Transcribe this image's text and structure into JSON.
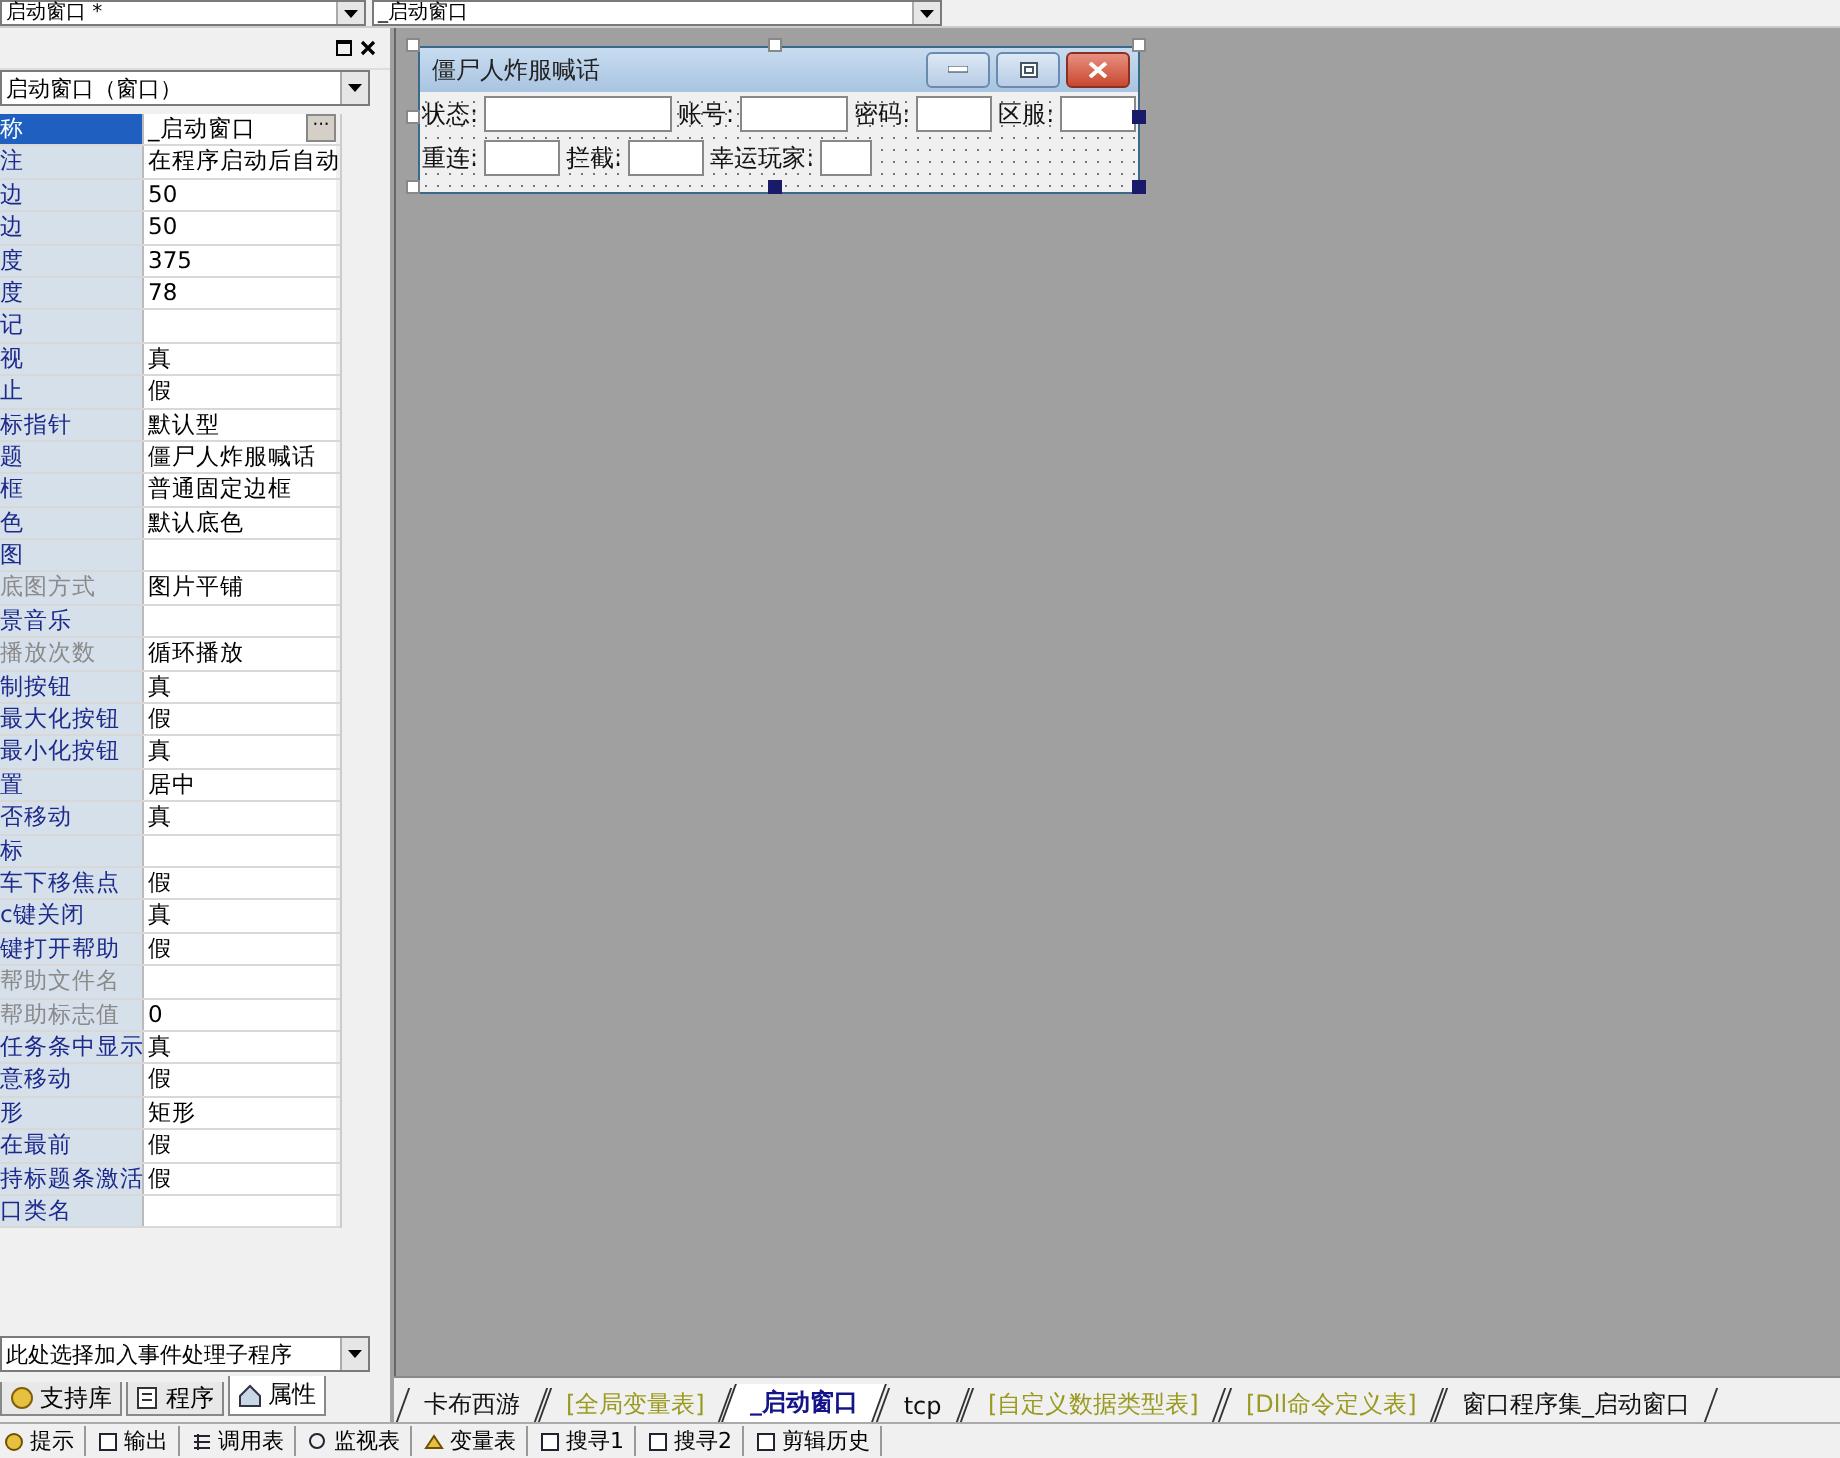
{
  "top_bar": {
    "object_combo": "启动窗口 *",
    "event_combo": "_启动窗口"
  },
  "property_panel": {
    "object_select": "启动窗口（窗口）",
    "edit_button": "···",
    "properties": [
      {
        "name": "称",
        "value": "_启动窗口",
        "selected": true,
        "disabled": false
      },
      {
        "name": "注",
        "value": "在程序启动后自动",
        "selected": false,
        "disabled": false
      },
      {
        "name": "边",
        "value": "50",
        "selected": false,
        "disabled": false
      },
      {
        "name": "边",
        "value": "50",
        "selected": false,
        "disabled": false
      },
      {
        "name": "度",
        "value": "375",
        "selected": false,
        "disabled": false
      },
      {
        "name": "度",
        "value": "78",
        "selected": false,
        "disabled": false
      },
      {
        "name": "记",
        "selected": false,
        "disabled": false
      },
      {
        "name": "视",
        "value": "真",
        "selected": false,
        "disabled": false
      },
      {
        "name": "止",
        "value": "假",
        "selected": false,
        "disabled": false
      },
      {
        "name": "标指针",
        "value": "默认型",
        "selected": false,
        "disabled": false
      },
      {
        "name": "题",
        "value": "僵尸人炸服喊话",
        "selected": false,
        "disabled": false
      },
      {
        "name": "框",
        "value": "普通固定边框",
        "selected": false,
        "disabled": false
      },
      {
        "name": "色",
        "value": "默认底色",
        "selected": false,
        "disabled": false
      },
      {
        "name": "图",
        "selected": false,
        "disabled": false
      },
      {
        "name": "底图方式",
        "value": "图片平铺",
        "selected": false,
        "disabled": true
      },
      {
        "name": "景音乐",
        "selected": false,
        "disabled": false
      },
      {
        "name": "播放次数",
        "value": "循环播放",
        "selected": false,
        "disabled": true
      },
      {
        "name": "制按钮",
        "value": "真",
        "selected": false,
        "disabled": false
      },
      {
        "name": "最大化按钮",
        "value": "假",
        "selected": false,
        "disabled": false
      },
      {
        "name": "最小化按钮",
        "value": "真",
        "selected": false,
        "disabled": false
      },
      {
        "name": "置",
        "value": "居中",
        "selected": false,
        "disabled": false
      },
      {
        "name": "否移动",
        "value": "真",
        "selected": false,
        "disabled": false
      },
      {
        "name": "标",
        "selected": false,
        "disabled": false
      },
      {
        "name": "车下移焦点",
        "value": "假",
        "selected": false,
        "disabled": false
      },
      {
        "name": "c键关闭",
        "value": "真",
        "selected": false,
        "disabled": false
      },
      {
        "name": "键打开帮助",
        "value": "假",
        "selected": false,
        "disabled": false
      },
      {
        "name": "帮助文件名",
        "selected": false,
        "disabled": true
      },
      {
        "name": "帮助标志值",
        "value": "0",
        "selected": false,
        "disabled": true
      },
      {
        "name": "任务条中显示",
        "value": "真",
        "selected": false,
        "disabled": false
      },
      {
        "name": "意移动",
        "value": "假",
        "selected": false,
        "disabled": false
      },
      {
        "name": "形",
        "value": "矩形",
        "selected": false,
        "disabled": false
      },
      {
        "name": "在最前",
        "value": "假",
        "selected": false,
        "disabled": false
      },
      {
        "name": "持标题条激活",
        "value": "假",
        "selected": false,
        "disabled": false
      },
      {
        "name": "口类名",
        "selected": false,
        "disabled": false
      }
    ],
    "event_select": "此处选择加入事件处理子程序",
    "tabs": [
      {
        "label": "支持库",
        "selected": false
      },
      {
        "label": "程序",
        "selected": false
      },
      {
        "label": "属性",
        "selected": true
      }
    ]
  },
  "designer": {
    "form": {
      "title": "僵尸人炸服喊话",
      "rows": [
        [
          {
            "label": "状态:"
          },
          {
            "label": "账号:"
          },
          {
            "label": "密码:"
          },
          {
            "label": "区服:"
          }
        ],
        [
          {
            "label": "重连:"
          },
          {
            "label": "拦截:"
          },
          {
            "label": "幸运玩家:"
          }
        ]
      ]
    }
  },
  "editor_tabs": [
    {
      "label": "卡布西游",
      "kind": "module",
      "selected": false
    },
    {
      "label": "[全局变量表]",
      "kind": "table",
      "selected": false
    },
    {
      "label": "_启动窗口",
      "kind": "window",
      "selected": true
    },
    {
      "label": "tcp",
      "kind": "module",
      "selected": false
    },
    {
      "label": "[自定义数据类型表]",
      "kind": "table",
      "selected": false
    },
    {
      "label": "[Dll命令定义表]",
      "kind": "table",
      "selected": false
    },
    {
      "label": "窗口程序集_启动窗口",
      "kind": "module",
      "selected": false
    }
  ],
  "status_bar": [
    "提示",
    "输出",
    "调用表",
    "监视表",
    "变量表",
    "搜寻1",
    "搜寻2",
    "剪辑历史"
  ]
}
